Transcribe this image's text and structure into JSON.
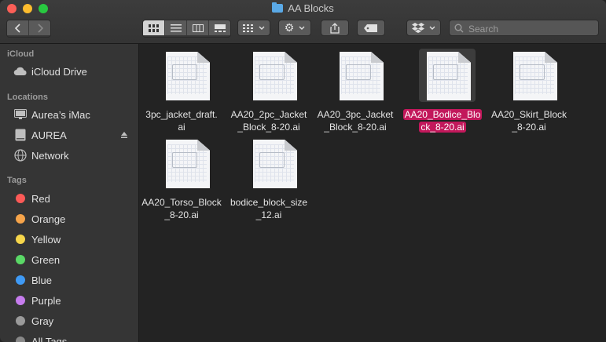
{
  "window": {
    "title": "AA Blocks",
    "folder_icon": "folder-icon"
  },
  "toolbar": {
    "back_icon": "chevron-left-icon",
    "forward_icon": "chevron-right-icon",
    "view_modes": [
      "icon-view",
      "list-view",
      "column-view",
      "gallery-view"
    ],
    "active_view": "icon-view",
    "group_icon": "grid-group-icon",
    "action_icon": "gear-icon",
    "share_icon": "share-icon",
    "tag_icon": "tag-icon",
    "dropbox_icon": "dropbox-icon",
    "search_placeholder": "Search"
  },
  "sidebar": {
    "sections": [
      {
        "title": "iCloud",
        "items": [
          {
            "label": "iCloud Drive",
            "icon": "cloud-icon"
          }
        ]
      },
      {
        "title": "Locations",
        "items": [
          {
            "label": "Aurea’s iMac",
            "icon": "imac-icon"
          },
          {
            "label": "AUREA",
            "icon": "disk-icon",
            "eject": "eject-icon"
          },
          {
            "label": "Network",
            "icon": "network-icon"
          }
        ]
      },
      {
        "title": "Tags",
        "items": [
          {
            "label": "Red",
            "color": "#fc5a57"
          },
          {
            "label": "Orange",
            "color": "#f6a44a"
          },
          {
            "label": "Yellow",
            "color": "#f7d64b"
          },
          {
            "label": "Green",
            "color": "#5ad866"
          },
          {
            "label": "Blue",
            "color": "#3f9af5"
          },
          {
            "label": "Purple",
            "color": "#c67cee"
          },
          {
            "label": "Gray",
            "color": "#9a9a9a"
          },
          {
            "label": "All Tags…",
            "icon": "all-tags-icon"
          }
        ]
      }
    ]
  },
  "files": [
    {
      "line1": "3pc_jacket_draft.",
      "line2": "ai",
      "selected": false
    },
    {
      "line1": "AA20_2pc_Jacket",
      "line2": "_Block_8-20.ai",
      "selected": false
    },
    {
      "line1": "AA20_3pc_Jacket",
      "line2": "_Block_8-20.ai",
      "selected": false
    },
    {
      "line1": "AA20_Bodice_Blo",
      "line2": "ck_8-20.ai",
      "selected": true
    },
    {
      "line1": "AA20_Skirt_Block",
      "line2": "_8-20.ai",
      "selected": false
    },
    {
      "line1": "AA20_Torso_Block",
      "line2": "_8-20.ai",
      "selected": false
    },
    {
      "line1": "bodice_block_size",
      "line2": "_12.ai",
      "selected": false
    }
  ],
  "colors": {
    "selection": "#c2185b",
    "sidebar_bg": "#353535",
    "content_bg": "#232323"
  }
}
